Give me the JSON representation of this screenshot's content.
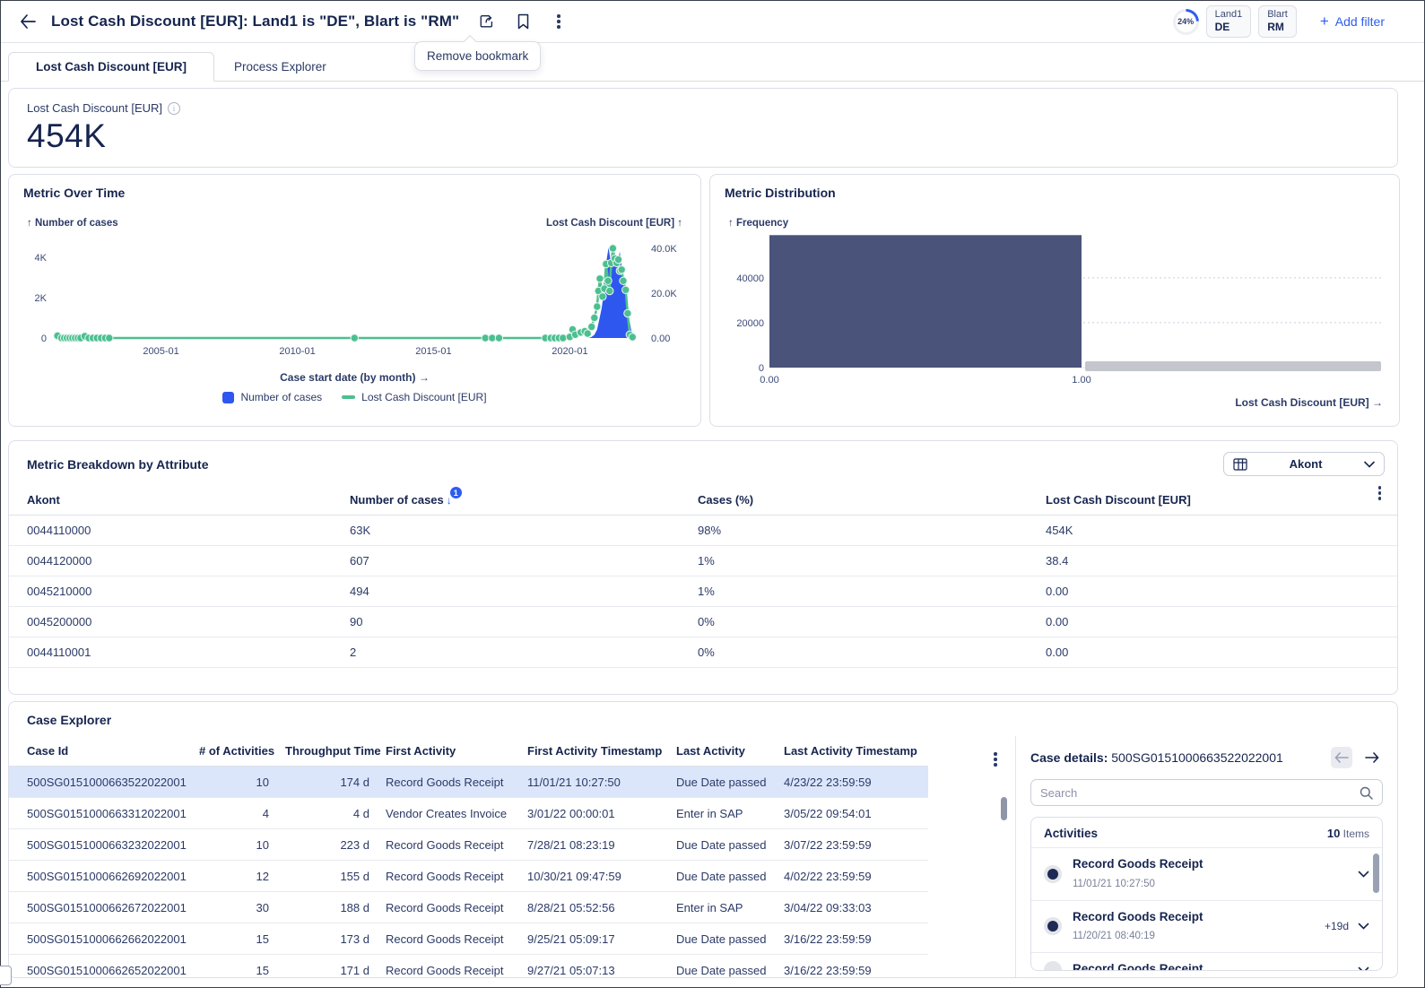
{
  "colors": {
    "accent_blue": "#2c5cf2",
    "series_blue": "#2e57f0",
    "series_green": "#4cbf90",
    "navy": "#16254f",
    "histogram_bar": "#4a537a",
    "scrollbar_gray": "#c3c6cc",
    "selected_row": "#dbe6fb",
    "link_blue": "#4d6ef2"
  },
  "header": {
    "title": "Lost Cash Discount [EUR]: Land1 is \"DE\", Blart is \"RM\"",
    "progress": "24%",
    "filters": [
      {
        "label": "Land1",
        "value": "DE"
      },
      {
        "label": "Blart",
        "value": "RM"
      }
    ],
    "add_filter_label": "Add filter",
    "tooltip": "Remove bookmark"
  },
  "tabs": [
    {
      "label": "Lost Cash Discount [EUR]",
      "active": true
    },
    {
      "label": "Process Explorer",
      "active": false
    }
  ],
  "kpi": {
    "label": "Lost Cash Discount [EUR]",
    "value": "454K"
  },
  "chart_data": [
    {
      "type": "line",
      "title": "Metric Over Time",
      "left_axis": {
        "label": "↑ Number of cases",
        "ticks": [
          "0",
          "2K",
          "4K"
        ],
        "tick_values": [
          0,
          2000,
          4000
        ],
        "max": 4900
      },
      "right_axis": {
        "label": "Lost Cash Discount [EUR] ↑",
        "ticks": [
          "0.00",
          "20.0K",
          "40.0K"
        ],
        "tick_values": [
          0,
          20000,
          40000
        ],
        "max": 44000
      },
      "x_ticks": [
        "2005-01",
        "2010-01",
        "2015-01",
        "2020-01"
      ],
      "x_tick_values": [
        2005,
        2010,
        2015,
        2020
      ],
      "x_range": [
        2001,
        2022.75
      ],
      "xlabel": "Case start date (by month) →",
      "legend": [
        "Number of cases",
        "Lost Cash Discount [EUR]"
      ],
      "series": [
        {
          "name": "Number of cases",
          "kind": "area",
          "axis": "left",
          "points": [
            [
              2020.7,
              0
            ],
            [
              2020.8,
              60
            ],
            [
              2020.9,
              160
            ],
            [
              2021.0,
              420
            ],
            [
              2021.08,
              900
            ],
            [
              2021.17,
              1500
            ],
            [
              2021.25,
              2300
            ],
            [
              2021.33,
              3700
            ],
            [
              2021.42,
              4500
            ],
            [
              2021.5,
              3800
            ],
            [
              2021.58,
              4700
            ],
            [
              2021.67,
              4000
            ],
            [
              2021.75,
              3500
            ],
            [
              2021.83,
              4300
            ],
            [
              2021.92,
              3400
            ],
            [
              2022.0,
              2900
            ],
            [
              2022.08,
              2100
            ],
            [
              2022.17,
              1000
            ],
            [
              2022.25,
              400
            ],
            [
              2022.33,
              60
            ],
            [
              2022.4,
              0
            ]
          ]
        },
        {
          "name": "Lost Cash Discount [EUR]",
          "kind": "line-markers",
          "axis": "right",
          "points": [
            [
              2001.2,
              1000
            ],
            [
              2001.35,
              0
            ],
            [
              2001.45,
              0
            ],
            [
              2001.55,
              0
            ],
            [
              2001.65,
              0
            ],
            [
              2001.75,
              0
            ],
            [
              2001.85,
              0
            ],
            [
              2001.95,
              0
            ],
            [
              2002.05,
              0
            ],
            [
              2002.2,
              800
            ],
            [
              2002.35,
              0
            ],
            [
              2002.5,
              0
            ],
            [
              2002.65,
              0
            ],
            [
              2002.8,
              0
            ],
            [
              2002.95,
              0
            ],
            [
              2003.1,
              0
            ],
            [
              2012.1,
              0
            ],
            [
              2016.9,
              0
            ],
            [
              2017.15,
              0
            ],
            [
              2017.4,
              0
            ],
            [
              2019.1,
              0
            ],
            [
              2019.3,
              0
            ],
            [
              2019.45,
              0
            ],
            [
              2019.6,
              0
            ],
            [
              2019.75,
              0
            ],
            [
              2020.0,
              500
            ],
            [
              2020.1,
              3800
            ],
            [
              2020.2,
              1500
            ],
            [
              2020.4,
              2500
            ],
            [
              2020.55,
              3000
            ],
            [
              2020.65,
              2000
            ],
            [
              2020.8,
              5000
            ],
            [
              2020.9,
              9000
            ],
            [
              2021.0,
              14000
            ],
            [
              2021.05,
              21000
            ],
            [
              2021.1,
              26500
            ],
            [
              2021.2,
              18500
            ],
            [
              2021.27,
              22000
            ],
            [
              2021.33,
              33000
            ],
            [
              2021.4,
              25500
            ],
            [
              2021.46,
              21000
            ],
            [
              2021.52,
              33500
            ],
            [
              2021.58,
              40000
            ],
            [
              2021.65,
              35500
            ],
            [
              2021.72,
              33500
            ],
            [
              2021.78,
              35000
            ],
            [
              2021.84,
              30000
            ],
            [
              2021.9,
              30500
            ],
            [
              2021.96,
              25500
            ],
            [
              2022.05,
              21500
            ],
            [
              2022.12,
              11000
            ],
            [
              2022.2,
              1500
            ],
            [
              2022.3,
              400
            ]
          ]
        }
      ]
    },
    {
      "type": "bar",
      "title": "Metric Distribution",
      "ylabel": "↑ Frequency",
      "xlabel": "Lost Cash Discount [EUR] →",
      "y_ticks": [
        "0",
        "20000",
        "40000"
      ],
      "y_tick_values": [
        0,
        20000,
        40000
      ],
      "ymax": 59500,
      "x_ticks": [
        "0.00",
        "1.00"
      ],
      "bins": [
        {
          "x0": 0,
          "x1": 1,
          "frequency": 59000
        }
      ]
    }
  ],
  "breakdown": {
    "title": "Metric Breakdown by Attribute",
    "selector_value": "Akont",
    "columns": [
      "Akont",
      "Number of cases",
      "Cases (%)",
      "Lost Cash Discount [EUR]"
    ],
    "sort": {
      "column": "Number of cases",
      "direction": "desc",
      "order_badge": "1"
    },
    "rows": [
      [
        "0044110000",
        "63K",
        "98%",
        "454K"
      ],
      [
        "0044120000",
        "607",
        "1%",
        "38.4"
      ],
      [
        "0045210000",
        "494",
        "1%",
        "0.00"
      ],
      [
        "0045200000",
        "90",
        "0%",
        "0.00"
      ],
      [
        "0044110001",
        "2",
        "0%",
        "0.00"
      ]
    ]
  },
  "case_explorer": {
    "title": "Case Explorer",
    "columns": [
      "Case Id",
      "# of Activities",
      "Throughput Time",
      "First Activity",
      "First Activity Timestamp",
      "Last Activity",
      "Last Activity Timestamp"
    ],
    "rows": [
      {
        "selected": true,
        "cells": [
          "500SG0151000663522022001",
          "10",
          "174 d",
          "Record Goods Receipt",
          "11/01/21 10:27:50",
          "Due Date passed",
          "4/23/22 23:59:59"
        ]
      },
      {
        "selected": false,
        "cells": [
          "500SG0151000663312022001",
          "4",
          "4 d",
          "Vendor Creates Invoice",
          "3/01/22 00:00:01",
          "Enter in SAP",
          "3/05/22 09:54:01"
        ]
      },
      {
        "selected": false,
        "cells": [
          "500SG0151000663232022001",
          "10",
          "223 d",
          "Record Goods Receipt",
          "7/28/21 08:23:19",
          "Due Date passed",
          "3/07/22 23:59:59"
        ]
      },
      {
        "selected": false,
        "cells": [
          "500SG0151000662692022001",
          "12",
          "155 d",
          "Record Goods Receipt",
          "10/30/21 09:47:59",
          "Due Date passed",
          "4/02/22 23:59:59"
        ]
      },
      {
        "selected": false,
        "cells": [
          "500SG0151000662672022001",
          "30",
          "188 d",
          "Record Goods Receipt",
          "8/28/21 05:52:56",
          "Enter in SAP",
          "3/04/22 09:33:03"
        ]
      },
      {
        "selected": false,
        "cells": [
          "500SG0151000662662022001",
          "15",
          "173 d",
          "Record Goods Receipt",
          "9/25/21 05:09:17",
          "Due Date passed",
          "3/16/22 23:59:59"
        ]
      },
      {
        "selected": false,
        "cells": [
          "500SG0151000662652022001",
          "15",
          "171 d",
          "Record Goods Receipt",
          "9/27/21 05:07:13",
          "Due Date passed",
          "3/16/22 23:59:59"
        ]
      }
    ]
  },
  "case_details": {
    "label": "Case details:",
    "case_id": "500SG0151000663522022001",
    "search_placeholder": "Search",
    "activities": {
      "title": "Activities",
      "count": "10",
      "count_suffix": "Items",
      "items": [
        {
          "name": "Record Goods Receipt",
          "timestamp": "11/01/21 10:27:50",
          "delta": "",
          "state": "done"
        },
        {
          "name": "Record Goods Receipt",
          "timestamp": "11/20/21 08:40:19",
          "delta": "+19d",
          "state": "done"
        },
        {
          "name": "Record Goods Receipt",
          "timestamp": "",
          "delta": "",
          "state": "pending"
        }
      ]
    }
  }
}
